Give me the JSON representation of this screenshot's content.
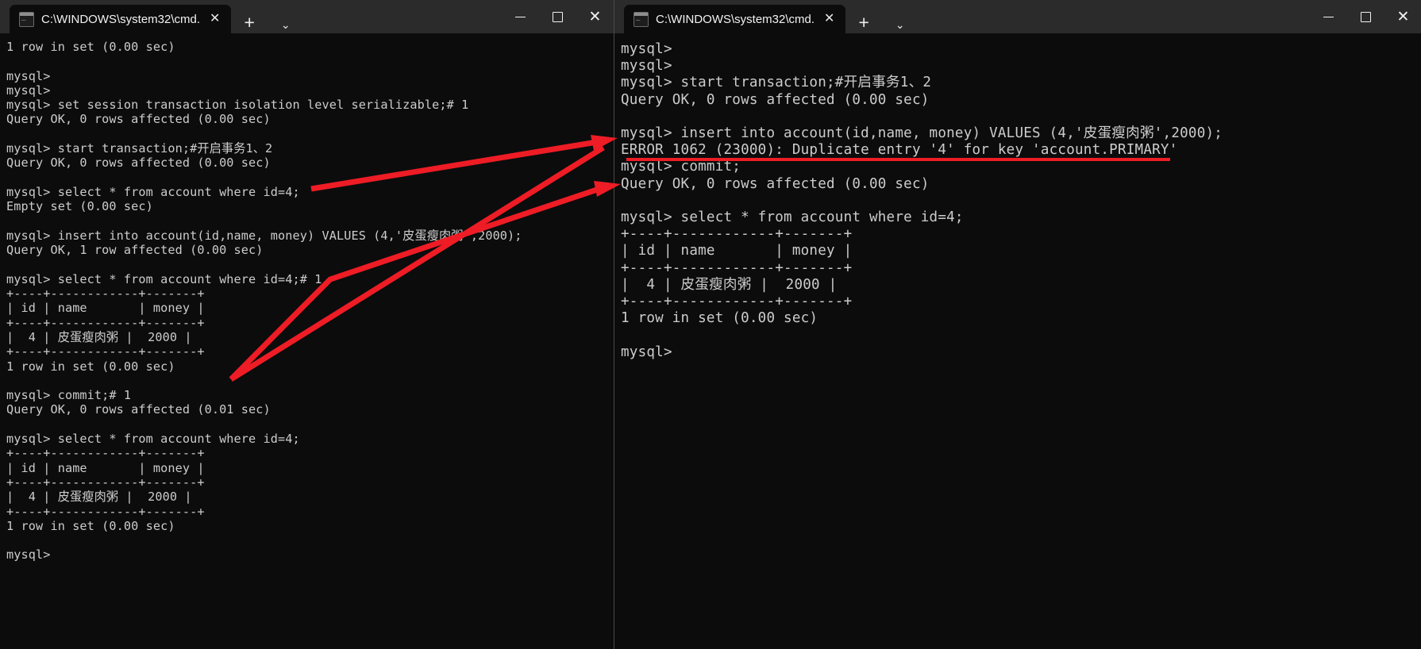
{
  "colors": {
    "terminal_background": "#0c0c0c",
    "terminal_text": "#cccccc",
    "titlebar_background": "#2b2b2b",
    "tab_active_background": "#0c0c0c",
    "annotation_red": "#ee1c25"
  },
  "left_window": {
    "titlebar": {
      "tab": {
        "icon": "cmd-console-icon",
        "title": "C:\\WINDOWS\\system32\\cmd.",
        "close_label": "✕"
      },
      "new_tab_label": "+",
      "dropdown_label": "⌄",
      "minimize_label": "—",
      "maximize_label": "□",
      "close_label": "✕"
    },
    "terminal_lines": [
      "1 row in set (0.00 sec)",
      "",
      "mysql>",
      "mysql>",
      "mysql> set session transaction isolation level serializable;# 1",
      "Query OK, 0 rows affected (0.00 sec)",
      "",
      "mysql> start transaction;#开启事务1、2",
      "Query OK, 0 rows affected (0.00 sec)",
      "",
      "mysql> select * from account where id=4;",
      "Empty set (0.00 sec)",
      "",
      "mysql> insert into account(id,name, money) VALUES (4,'皮蛋瘦肉粥',2000);",
      "Query OK, 1 row affected (0.00 sec)",
      "",
      "mysql> select * from account where id=4;# 1",
      "+----+------------+-------+",
      "| id | name       | money |",
      "+----+------------+-------+",
      "|  4 | 皮蛋瘦肉粥 |  2000 |",
      "+----+------------+-------+",
      "1 row in set (0.00 sec)",
      "",
      "mysql> commit;# 1",
      "Query OK, 0 rows affected (0.01 sec)",
      "",
      "mysql> select * from account where id=4;",
      "+----+------------+-------+",
      "| id | name       | money |",
      "+----+------------+-------+",
      "|  4 | 皮蛋瘦肉粥 |  2000 |",
      "+----+------------+-------+",
      "1 row in set (0.00 sec)",
      "",
      "mysql>"
    ]
  },
  "right_window": {
    "titlebar": {
      "tab": {
        "icon": "cmd-console-icon",
        "title": "C:\\WINDOWS\\system32\\cmd.",
        "close_label": "✕"
      },
      "new_tab_label": "+",
      "dropdown_label": "⌄",
      "minimize_label": "—",
      "maximize_label": "□",
      "close_label": "✕"
    },
    "terminal_lines": [
      "mysql>",
      "mysql>",
      "mysql> start transaction;#开启事务1、2",
      "Query OK, 0 rows affected (0.00 sec)",
      "",
      "mysql> insert into account(id,name, money) VALUES (4,'皮蛋瘦肉粥',2000);",
      "ERROR 1062 (23000): Duplicate entry '4' for key 'account.PRIMARY'",
      "mysql> commit;",
      "Query OK, 0 rows affected (0.00 sec)",
      "",
      "mysql> select * from account where id=4;",
      "+----+------------+-------+",
      "| id | name       | money |",
      "+----+------------+-------+",
      "|  4 | 皮蛋瘦肉粥 |  2000 |",
      "+----+------------+-------+",
      "1 row in set (0.00 sec)",
      "",
      "mysql>"
    ]
  },
  "annotations": {
    "underline_target": "ERROR 1062 (23000): Duplicate entry '4' for key 'account.PRIMARY'",
    "arrow_count": 2,
    "underline_count": 1
  }
}
